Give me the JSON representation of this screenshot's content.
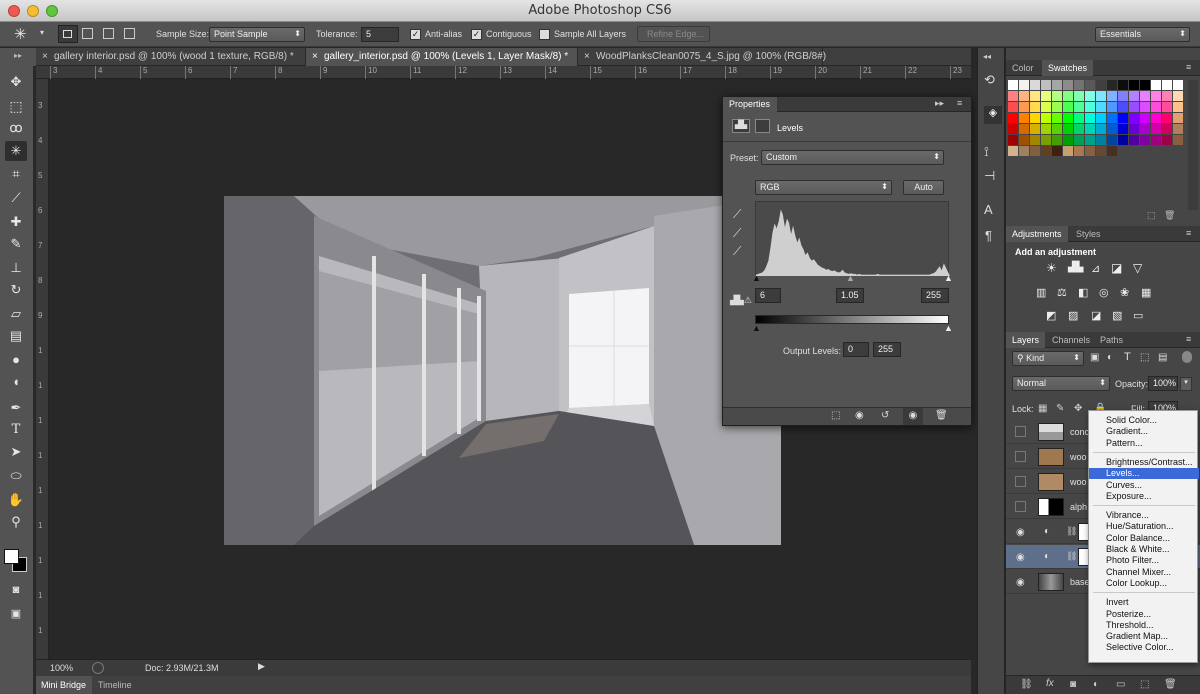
{
  "app": {
    "title": "Adobe Photoshop CS6",
    "workspace": "Essentials",
    "traffic_lights": [
      "#ee5a52",
      "#f5bd2f",
      "#5fc63d"
    ]
  },
  "options_bar": {
    "sample_size_label": "Sample Size:",
    "sample_size_value": "Point Sample",
    "tolerance_label": "Tolerance:",
    "tolerance_value": "5",
    "anti_alias_label": "Anti-alias",
    "contiguous_label": "Contiguous",
    "sample_all_layers_label": "Sample All Layers",
    "refine_edge_label": "Refine Edge..."
  },
  "doc_tabs": [
    {
      "label": "gallery interior.psd @ 100% (wood 1 texture, RGB/8) *",
      "active": false
    },
    {
      "label": "gallery_interior.psd @ 100% (Levels 1, Layer Mask/8) *",
      "active": true
    },
    {
      "label": "WoodPlanksClean0075_4_S.jpg @ 100% (RGB/8#)",
      "active": false
    }
  ],
  "ruler_h_numbers": [
    "3",
    "4",
    "5",
    "6",
    "7",
    "8",
    "9",
    "10",
    "11",
    "12",
    "13",
    "14",
    "15",
    "16",
    "17",
    "18",
    "19",
    "20",
    "21",
    "22",
    "23"
  ],
  "ruler_v_numbers": [
    "3",
    "4",
    "5",
    "6",
    "7",
    "8",
    "9",
    "1",
    "1",
    "1",
    "1",
    "1",
    "1",
    "1",
    "1",
    "1"
  ],
  "status": {
    "zoom": "100%",
    "doc": "Doc: 2.93M/21.3M"
  },
  "bottom_tabs": [
    "Mini Bridge",
    "Timeline"
  ],
  "properties": {
    "tab": "Properties",
    "adjustment_name": "Levels",
    "preset_label": "Preset:",
    "preset_value": "Custom",
    "channel_value": "RGB",
    "auto_label": "Auto",
    "input_black": "6",
    "input_gamma": "1.05",
    "input_white": "255",
    "output_label": "Output Levels:",
    "output_black": "0",
    "output_white": "255",
    "histogram": [
      2,
      3,
      4,
      5,
      8,
      14,
      22,
      40,
      62,
      75,
      68,
      78,
      95,
      88,
      70,
      82,
      76,
      60,
      72,
      58,
      48,
      55,
      44,
      38,
      30,
      34,
      26,
      22,
      24,
      20,
      16,
      14,
      12,
      11,
      9,
      10,
      8,
      7,
      8,
      6,
      5,
      6,
      9,
      5,
      4,
      3,
      4,
      3,
      3,
      2,
      3,
      2,
      2,
      2,
      2,
      2,
      2,
      2,
      2,
      3,
      2,
      2,
      2,
      2,
      2,
      2,
      2,
      2,
      2,
      2,
      2,
      2,
      2,
      2,
      2,
      2,
      2,
      2,
      2,
      2,
      2,
      2,
      2,
      2,
      2,
      3,
      4,
      6,
      10,
      14,
      8,
      18,
      12,
      6
    ]
  },
  "color_panel": {
    "tabs": [
      "Color",
      "Swatches"
    ],
    "swatch_rows": [
      [
        "#ffffff",
        "#f2f2f2",
        "#d9d9d9",
        "#bfbfbf",
        "#a6a6a6",
        "#8c8c8c",
        "#737373",
        "#595959",
        "#404040",
        "#262626",
        "#0d0d0d",
        "#000000",
        "#000000",
        "#ffffff",
        "#ffffff",
        "#ffffff",
        "#ffffff",
        "#ffffff"
      ],
      [
        "#ff8080",
        "#ffb380",
        "#ffe680",
        "#e6ff80",
        "#b3ff80",
        "#80ff80",
        "#80ffb3",
        "#80ffe6",
        "#80e6ff",
        "#80b3ff",
        "#8080ff",
        "#b380ff",
        "#e680ff",
        "#ff80e6",
        "#ff80b3",
        "#ffd9b3"
      ],
      [
        "#ff4d4d",
        "#ff994d",
        "#ffdb4d",
        "#dbff4d",
        "#99ff4d",
        "#4dff4d",
        "#4dff99",
        "#4dffdb",
        "#4ddbff",
        "#4d99ff",
        "#4d4dff",
        "#994dff",
        "#db4dff",
        "#ff4ddb",
        "#ff4d99",
        "#ffc08a"
      ],
      [
        "#ff0000",
        "#ff7f00",
        "#ffd700",
        "#bfff00",
        "#66ff00",
        "#00ff00",
        "#00ff80",
        "#00ffd9",
        "#00cfff",
        "#0070ff",
        "#0000ff",
        "#7f00ff",
        "#cf00ff",
        "#ff00cf",
        "#ff0070",
        "#e0a070"
      ],
      [
        "#d40000",
        "#d46a00",
        "#d4b300",
        "#9fd400",
        "#55d400",
        "#00d400",
        "#00d46a",
        "#00d4b3",
        "#00aad4",
        "#005dd4",
        "#0000d4",
        "#6a00d4",
        "#aa00d4",
        "#d400aa",
        "#d4005d",
        "#b0805a"
      ],
      [
        "#a00000",
        "#a05000",
        "#a08700",
        "#78a000",
        "#40a000",
        "#00a000",
        "#00a050",
        "#00a087",
        "#0080a0",
        "#0046a0",
        "#0000a0",
        "#5000a0",
        "#8000a0",
        "#a00080",
        "#a00046",
        "#8a5f3e"
      ],
      [
        "#d2b48c",
        "#a08060",
        "#806040",
        "#604020",
        "#402010",
        "#c8a070",
        "#a87850",
        "#886040",
        "#684830",
        "#483020"
      ]
    ]
  },
  "adjustments_panel": {
    "tabs": [
      "Adjustments",
      "Styles"
    ],
    "heading": "Add an adjustment"
  },
  "layers_panel": {
    "tabs": [
      "Layers",
      "Channels",
      "Paths"
    ],
    "kind_label": "Kind",
    "blend_mode": "Normal",
    "opacity_label": "Opacity:",
    "opacity_value": "100%",
    "lock_label": "Lock:",
    "fill_label": "Fill:",
    "fill_value": "100%",
    "layers": [
      {
        "name": "conc",
        "visible": false,
        "thumb": "concrete"
      },
      {
        "name": "woo",
        "visible": false,
        "thumb": "wood1"
      },
      {
        "name": "woo",
        "visible": false,
        "thumb": "wood2"
      },
      {
        "name": "alph",
        "visible": false,
        "thumb": "alpha"
      },
      {
        "name": "",
        "visible": true,
        "thumb": "adjust"
      },
      {
        "name": "",
        "visible": true,
        "thumb": "adjust-selected"
      },
      {
        "name": "base",
        "visible": true,
        "thumb": "base"
      }
    ]
  },
  "adjustment_menu": {
    "groups": [
      [
        "Solid Color...",
        "Gradient...",
        "Pattern..."
      ],
      [
        "Brightness/Contrast...",
        "Levels...",
        "Curves...",
        "Exposure..."
      ],
      [
        "Vibrance...",
        "Hue/Saturation...",
        "Color Balance...",
        "Black & White...",
        "Photo Filter...",
        "Channel Mixer...",
        "Color Lookup..."
      ],
      [
        "Invert",
        "Posterize...",
        "Threshold...",
        "Gradient Map...",
        "Selective Color..."
      ]
    ],
    "highlighted": "Levels..."
  }
}
